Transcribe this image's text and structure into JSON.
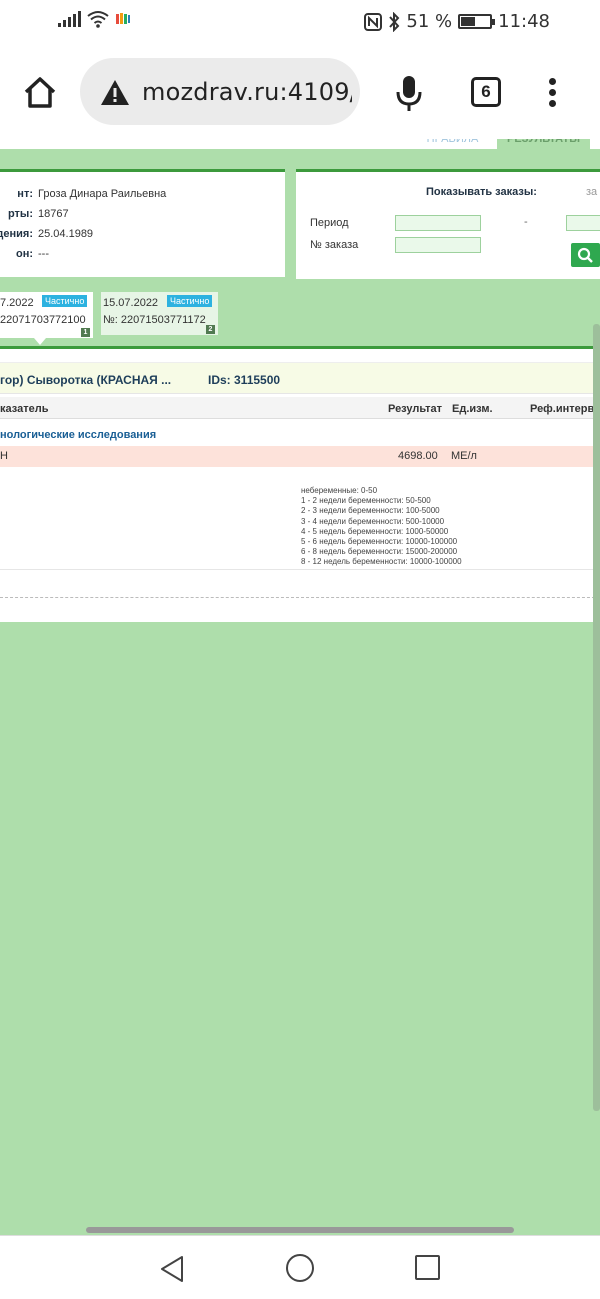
{
  "status_bar": {
    "battery_percent": "51 %",
    "time": "11:48",
    "battery_level": 0.51
  },
  "browser": {
    "url": "mozdrav.ru:4109/",
    "tab_count": "6"
  },
  "page_tabs": {
    "tab_rules": "ПРАВИЛА",
    "tab_results": "РЕЗУЛЬТАТЫ"
  },
  "patient": {
    "rows": [
      {
        "label": "нт:",
        "value": "Гроза Динара Раильевна"
      },
      {
        "label": "рты:",
        "value": "18767"
      },
      {
        "label": "дения:",
        "value": "25.04.1989"
      },
      {
        "label": "он:",
        "value": "---"
      }
    ]
  },
  "filter": {
    "title": "Показывать заказы:",
    "extra": "за",
    "period_label": "Период",
    "order_label": "№ заказа",
    "dash": "-"
  },
  "orders": [
    {
      "date": "7.2022",
      "status": "Частично",
      "number": "22071703772100",
      "index": "1"
    },
    {
      "date": "15.07.2022",
      "status": "Частично",
      "number": "№: 22071503771172",
      "index": "2"
    }
  ],
  "results": {
    "title": "гор) Сыворотка (КРАСНАЯ ...",
    "ids": "IDs: 3115500",
    "columns": {
      "indicator": "казатель",
      "result": "Результат",
      "unit": "Ед.изм.",
      "ref": "Реф.интервал"
    },
    "group": "нологические исследования",
    "row": {
      "name": "Н",
      "value": "4698.00",
      "unit": "МЕ/л"
    },
    "ref_lines": [
      "небеременные: 0-50",
      "1 - 2 недели беременности: 50-500",
      "2 - 3 недели беременности: 100-5000",
      "3 - 4 недели беременности: 500-10000",
      "4 - 5 недель беременности: 1000-50000",
      "5 - 6 недель беременности: 10000-100000",
      "6 - 8 недель беременности: 15000-200000",
      "8 - 12 недель беременности: 10000-100000"
    ]
  }
}
